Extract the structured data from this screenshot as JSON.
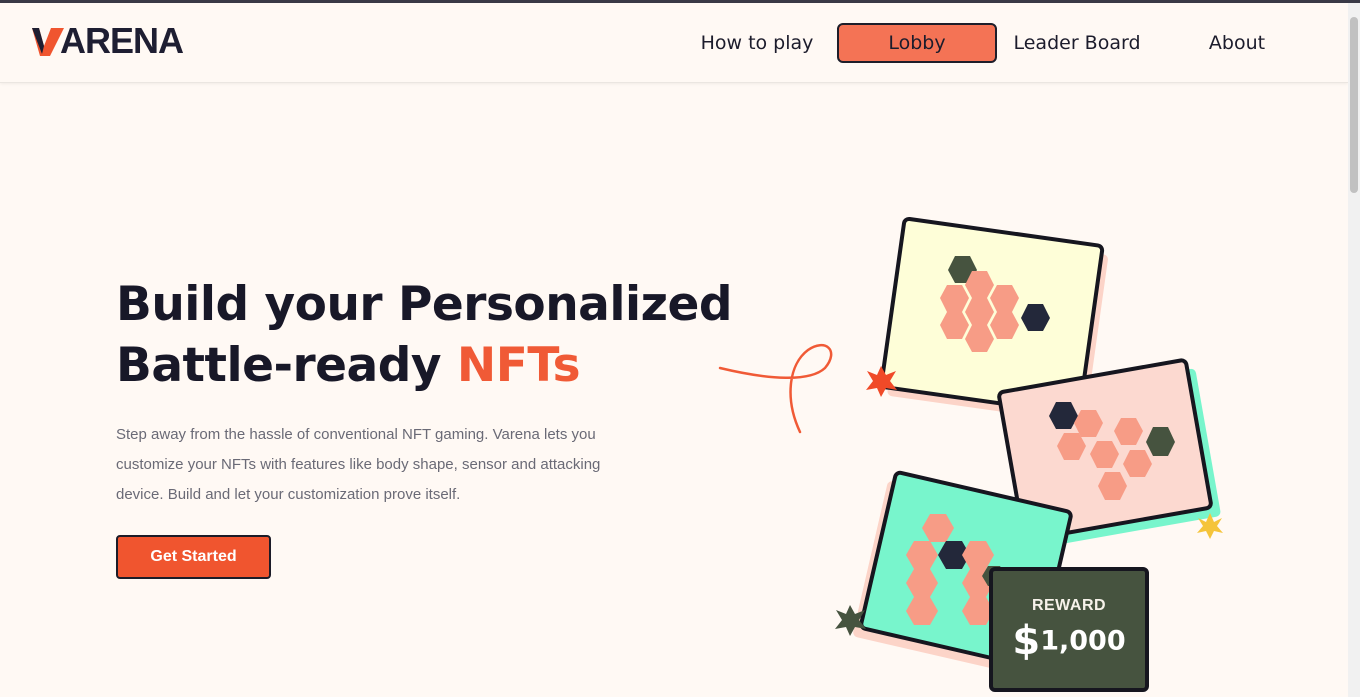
{
  "brand": {
    "logo_text": "ARENA",
    "accent_color": "#f0552f"
  },
  "nav": {
    "items": [
      {
        "label": "How to play"
      },
      {
        "label": "Lobby",
        "active": true
      },
      {
        "label": "Leader Board"
      },
      {
        "label": "About"
      }
    ]
  },
  "hero": {
    "title_line1": "Build your Personalized",
    "title_line2": "Battle-ready ",
    "title_accent": "NFTs",
    "description": "Step away from the hassle of conventional NFT gaming. Varena lets you customize your NFTs with features like body shape, sensor and attacking device. Build and let your customization prove itself.",
    "cta_label": "Get Started"
  },
  "illustration": {
    "reward_label": "REWARD",
    "reward_currency": "$",
    "reward_amount": "1,000",
    "colors": {
      "card_yellow": "#fefed8",
      "card_pink": "#fcd9d0",
      "card_mint": "#78f5cc",
      "hex_salmon": "#f79c86",
      "hex_dark": "#23283a",
      "hex_olive": "#46533f",
      "star_orange": "#f04a28",
      "star_yellow": "#f5c43a"
    }
  }
}
